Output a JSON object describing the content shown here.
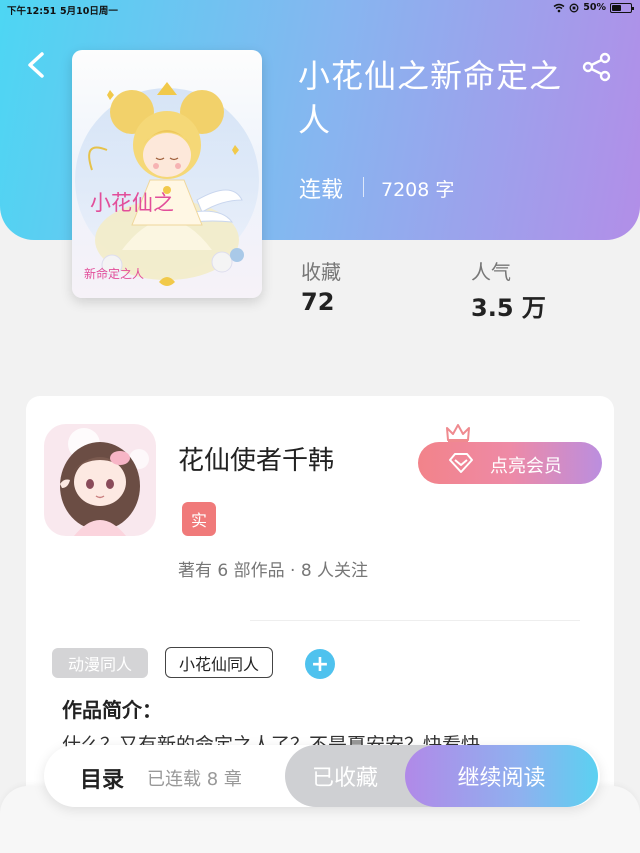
{
  "status_bar": {
    "time": "下午12:51",
    "date": "5月10日周一",
    "battery": "50%"
  },
  "book": {
    "title": "小花仙之新命定之人",
    "status": "连载",
    "word_count": "7208 字",
    "cover_title_art": "小花仙之",
    "cover_subtitle_art": "新命定之人"
  },
  "stats": [
    {
      "label": "收藏",
      "value": "72"
    },
    {
      "label": "人气",
      "value": "3.5 万"
    }
  ],
  "author": {
    "name": "花仙使者千韩",
    "badge": "实",
    "meta": "著有 6 部作品 · 8 人关注",
    "vip_button": "点亮会员"
  },
  "tags": {
    "category": "动漫同人",
    "custom": "小花仙同人",
    "add": "+"
  },
  "intro": {
    "title": "作品简介：",
    "text": "什么？又有新的命定之人了？不是夏安安？快看快"
  },
  "bottom_bar": {
    "toc_label": "目录",
    "chapter_count": "已连载 8 章",
    "collected_button": "已收藏",
    "continue_button": "继续阅读"
  },
  "colors": {
    "header_gradient_start": "#4dd6f3",
    "header_gradient_end": "#b28ee8",
    "vip_pink": "#f2838a",
    "real_badge": "#f07a7a",
    "add_tag": "#4fc2ee"
  },
  "icons": [
    "back-chevron-icon",
    "share-icon",
    "diamond-icon",
    "crown-icon",
    "wifi-icon",
    "battery-icon"
  ]
}
